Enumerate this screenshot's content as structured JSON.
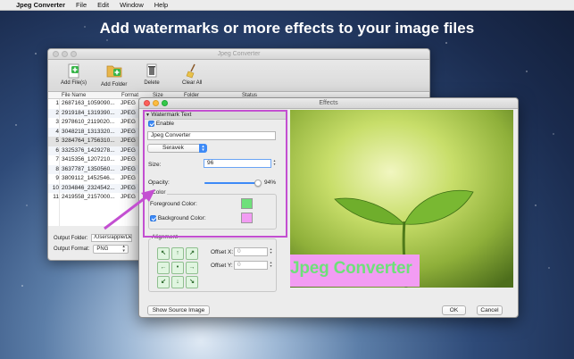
{
  "menubar": {
    "app_name": "Jpeg Converter",
    "items": [
      "File",
      "Edit",
      "Window",
      "Help"
    ]
  },
  "headline": "Add watermarks or more effects to your image files",
  "main_window": {
    "title": "Jpeg Converter",
    "toolbar": {
      "add_files": "Add File(s)",
      "add_folder": "Add Folder",
      "delete": "Delete",
      "clear_all": "Clear All"
    },
    "columns": [
      "File Name",
      "Format",
      "Size",
      "Folder",
      "Status"
    ],
    "rows": [
      {
        "num": "1",
        "file": "2687163_1059090...",
        "format": "JPEG"
      },
      {
        "num": "2",
        "file": "2919184_1319390...",
        "format": "JPEG"
      },
      {
        "num": "3",
        "file": "2978610_2119020...",
        "format": "JPEG"
      },
      {
        "num": "4",
        "file": "3048218_1313320...",
        "format": "JPEG"
      },
      {
        "num": "5",
        "file": "3284764_1756310...",
        "format": "JPEG"
      },
      {
        "num": "6",
        "file": "3325376_1429278...",
        "format": "JPEG"
      },
      {
        "num": "7",
        "file": "3415356_1207210...",
        "format": "JPEG"
      },
      {
        "num": "8",
        "file": "3637787_1350560...",
        "format": "JPEG"
      },
      {
        "num": "9",
        "file": "3809112_1452546...",
        "format": "JPEG"
      },
      {
        "num": "10",
        "file": "2034846_2324542...",
        "format": "JPEG"
      },
      {
        "num": "11",
        "file": "2419558_2157000...",
        "format": "JPEG"
      }
    ],
    "output_folder_label": "Output Folder:",
    "output_folder_value": "/Users/apple/Des",
    "output_format_label": "Output Format:",
    "output_format_value": "PNG"
  },
  "effects_dialog": {
    "title": "Effects",
    "section_title": "Watermark Text",
    "enable_label": "Enable",
    "text_value": "Jpeg Converter",
    "font_value": "Seravek",
    "size_label": "Size:",
    "size_value": "96",
    "opacity_label": "Opacity:",
    "opacity_value": 0.94,
    "opacity_text": "94%",
    "color_group_title": "Color",
    "foreground_label": "Foreground Color:",
    "background_label": "Background Color:",
    "foreground_color": "#6ee07a",
    "background_color": "#f29cf3",
    "alignment_title": "Alignment",
    "alignment_arrows": [
      "↖",
      "↑",
      "↗",
      "←",
      "•",
      "→",
      "↙",
      "↓",
      "↘"
    ],
    "offset_x_label": "Offset X:",
    "offset_x_value": "0",
    "offset_y_label": "Offset Y:",
    "offset_y_value": "0",
    "show_source_button": "Show Source Image",
    "ok_button": "OK",
    "cancel_button": "Cancel",
    "preview_watermark_text": "Jpeg Converter"
  },
  "colors": {
    "accent": "#3d8af7",
    "highlight": "#c34fd1"
  }
}
